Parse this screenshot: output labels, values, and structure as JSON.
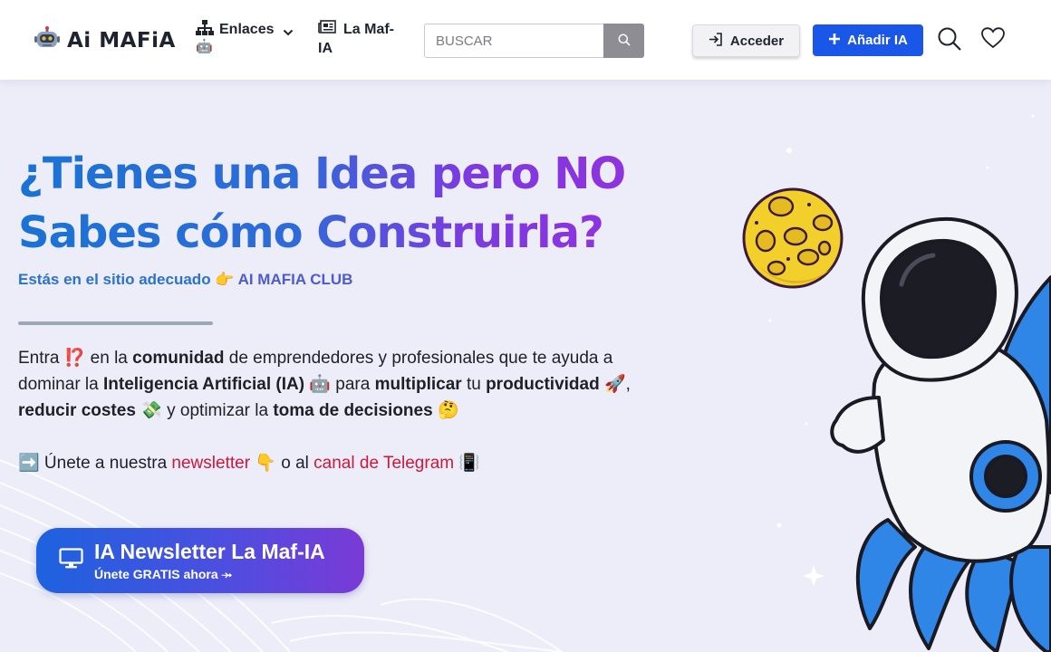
{
  "header": {
    "logo_text": "Ai MAFiA",
    "nav_enlaces": "Enlaces",
    "nav_enlaces_emoji": "🤖",
    "nav_mafia_line1": "La Maf-",
    "nav_mafia_line2": "IA",
    "search_placeholder": "BUSCAR",
    "login_label": "Acceder",
    "add_ai_label": "Añadir IA"
  },
  "hero": {
    "title": "¿Tienes una Idea pero NO Sabes cómo Construirla?",
    "subtitle_prefix": "Estás en el sitio adecuado 👉",
    "subtitle_club": "AI MAFIA CLUB",
    "desc": {
      "p1": "Entra ",
      "p1_emoji": "⁉️",
      "p2": " en la ",
      "b1": "comunidad",
      "p3": " de emprendedores y profesionales que te ayuda a dominar la ",
      "b2": "Inteligencia Artificial (IA)",
      "p4": " 🤖 para ",
      "b3": "multiplicar",
      "p5": " tu ",
      "b4": "productividad",
      "p6": " 🚀,  ",
      "b5": "reducir costes",
      "p7": " 💸 y optimizar la ",
      "b6": "toma de decisiones",
      "p8": " 🤔"
    },
    "join": {
      "prefix": "➡️ Únete a nuestra ",
      "newsletter_link": "newsletter",
      "middle": " 👇 o al ",
      "telegram_link": "canal de Telegram",
      "suffix": " 📳"
    },
    "cta": {
      "title": "IA Newsletter La Maf-IA",
      "subtitle": "Únete GRATIS ahora ⤞"
    }
  },
  "icons": {
    "logo": "robot-icon",
    "enlaces": "sitemap-icon",
    "mafia": "newspaper-icon",
    "search_button": "search-icon",
    "login": "sign-in-icon",
    "add": "plus-icon",
    "header_search": "search-icon",
    "favorites": "heart-icon",
    "cta": "desktop-icon"
  },
  "colors": {
    "primary": "#1a56e8",
    "title_gradient_start": "#1a73d4",
    "title_gradient_end": "#9a2ee0",
    "link_red": "#d1163a",
    "background": "#ecedf9"
  }
}
